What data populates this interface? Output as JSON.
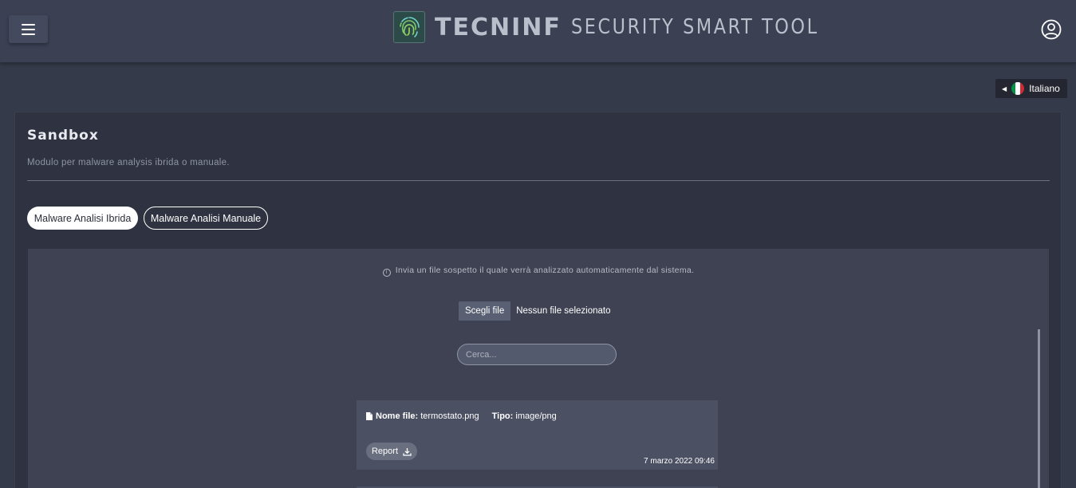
{
  "header": {
    "brand_bold": "TECNINF",
    "brand_light": "SECURITY SMART TOOL",
    "icons": {
      "menu": "hamburger-menu-icon",
      "logo": "fingerprint-icon",
      "user": "user-circle-icon"
    }
  },
  "language": {
    "label": "Italiano",
    "flag": [
      "#009246",
      "#ffffff",
      "#ce2b37"
    ]
  },
  "card": {
    "title": "Sandbox",
    "subtitle": "Modulo per malware analysis ibrida o manuale."
  },
  "tabs": [
    {
      "label": "Malware Analisi Ibrida",
      "active": true
    },
    {
      "label": "Malware Analisi Manuale",
      "active": false
    }
  ],
  "upload": {
    "info": "Invia un file sospetto il quale verrà analizzato automaticamente dal sistema.",
    "choose_label": "Scegli file",
    "status": "Nessun file selezionato"
  },
  "search": {
    "placeholder": "Cerca...",
    "value": ""
  },
  "files": [
    {
      "name_label": "Nome file:",
      "name": "termostato.png",
      "type_label": "Tipo:",
      "type": "image/png",
      "report_label": "Report",
      "date": "7 marzo 2022 09:46"
    }
  ]
}
